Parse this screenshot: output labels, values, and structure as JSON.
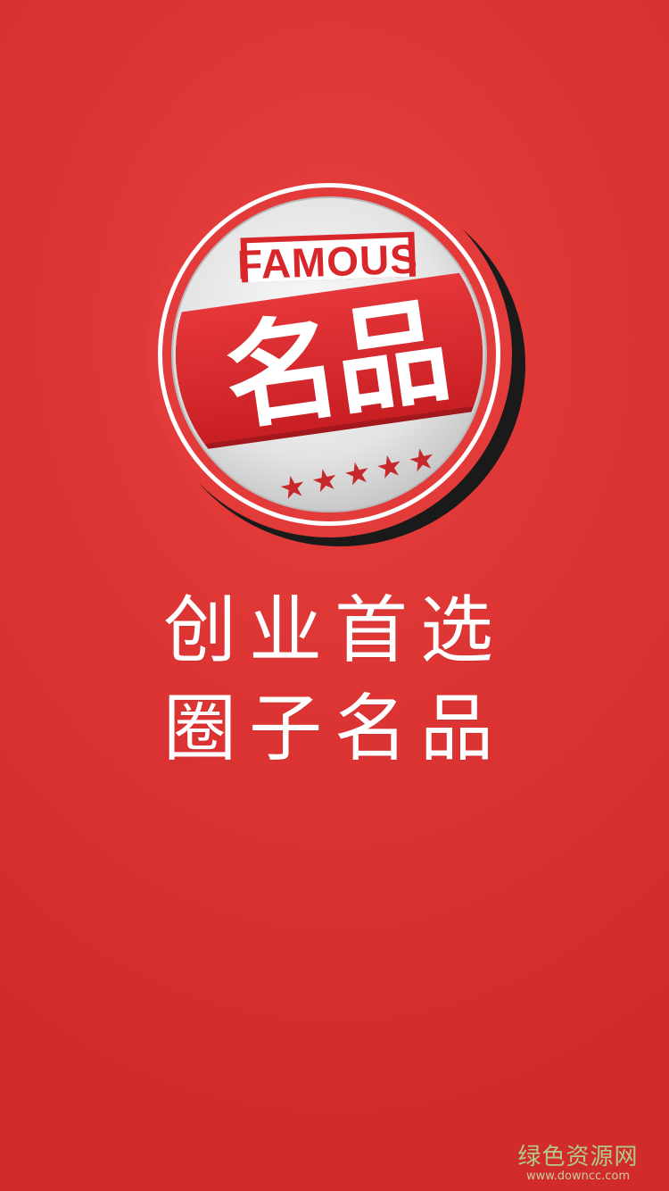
{
  "logo": {
    "badge_text": "FAMOUS",
    "main_text": "名品",
    "stars": [
      "★",
      "★",
      "★",
      "★",
      "★"
    ]
  },
  "slogan": {
    "line1": "创业首选",
    "line2": "圈子名品"
  },
  "watermark": {
    "name": "绿色资源网",
    "url": "www.downcc.com"
  },
  "colors": {
    "background": "#dd3534",
    "ribbon": "#d8262a",
    "badge_circle": "#e03a3a",
    "inner_disc": "#e8e8e8",
    "stars": "#c6282b",
    "text": "#ffffff"
  }
}
